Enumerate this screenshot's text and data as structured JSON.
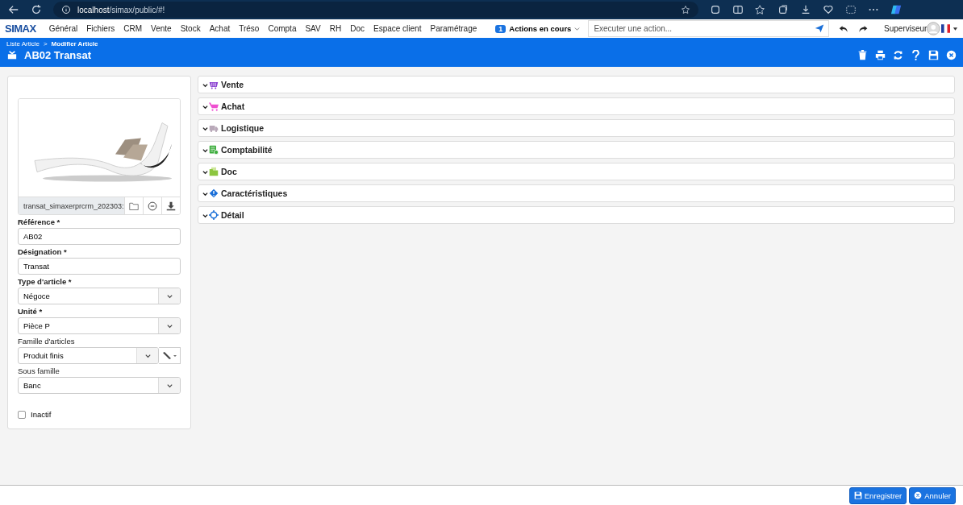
{
  "browser": {
    "url_host": "localhost",
    "url_path": "/simax/public/#!"
  },
  "app": {
    "logo": "SIMAX",
    "menu": [
      "Général",
      "Fichiers",
      "CRM",
      "Vente",
      "Stock",
      "Achat",
      "Tréso",
      "Compta",
      "SAV",
      "RH",
      "Doc",
      "Espace client",
      "Paramétrage"
    ],
    "actions_count": "1",
    "actions_label": "Actions en cours",
    "command_placeholder": "Executer une action...",
    "user": "Superviseur"
  },
  "breadcrumb": [
    "Liste Article",
    "Modifier Article"
  ],
  "breadcrumb_sep": ">",
  "title": "AB02 Transat",
  "image": {
    "filename": "transat_simaxerprcrm_202303:"
  },
  "fields": [
    {
      "label": "Référence *",
      "required": true,
      "kind": "text",
      "value": "AB02"
    },
    {
      "label": "Désignation *",
      "required": true,
      "kind": "text",
      "value": "Transat"
    },
    {
      "label": "Type d'article *",
      "required": true,
      "kind": "select",
      "value": "Négoce"
    },
    {
      "label": "Unité *",
      "required": true,
      "kind": "select",
      "value": "Pièce P"
    },
    {
      "label": "Famille d'articles",
      "required": false,
      "kind": "select-edit",
      "value": "Produit finis"
    },
    {
      "label": "Sous famille",
      "required": false,
      "kind": "select",
      "value": "Banc"
    }
  ],
  "inactive": {
    "label": "Inactif",
    "checked": false
  },
  "sections": [
    {
      "label": "Vente",
      "kind": "basket",
      "color": "#8a3fd1",
      "expanded": false
    },
    {
      "label": "Achat",
      "kind": "cart",
      "color": "#ee4fd0",
      "expanded": false
    },
    {
      "label": "Logistique",
      "kind": "truck",
      "color": "#b9a9b9",
      "expanded": false
    },
    {
      "label": "Comptabilité",
      "kind": "calc",
      "color": "#3fae3f",
      "expanded": false
    },
    {
      "label": "Doc",
      "kind": "folder",
      "color": "#8cc63f",
      "expanded": false
    },
    {
      "label": "Caractéristiques",
      "kind": "diamond",
      "color": "#1a6fd8",
      "expanded": false
    },
    {
      "label": "Détail",
      "kind": "target",
      "color": "#1a6fd8",
      "expanded": false
    }
  ],
  "footer_buttons": [
    {
      "label": "Enregistrer",
      "kind": "save"
    },
    {
      "label": "Annuler",
      "kind": "cancel"
    }
  ]
}
